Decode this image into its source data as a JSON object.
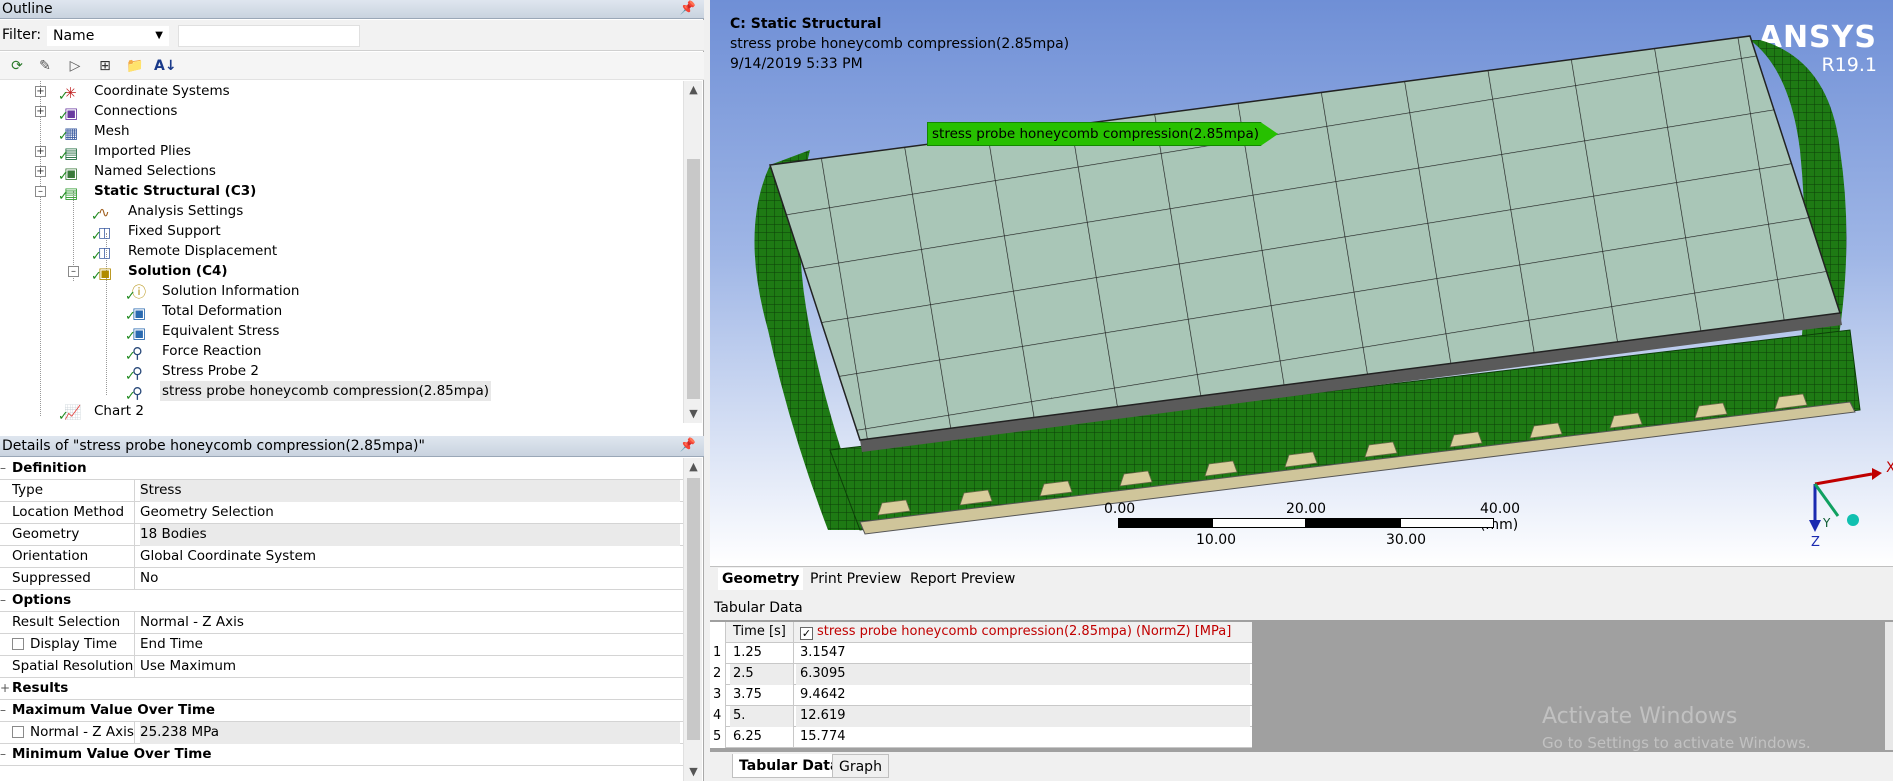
{
  "outline": {
    "title": "Outline",
    "filter_label": "Filter:",
    "filter_value": "Name",
    "filter_text": "",
    "tree": [
      {
        "label": "Coordinate Systems",
        "icon": "coordinate-systems-icon"
      },
      {
        "label": "Connections",
        "icon": "connections-icon"
      },
      {
        "label": "Mesh",
        "icon": "mesh-icon"
      },
      {
        "label": "Imported Plies",
        "icon": "imported-plies-icon"
      },
      {
        "label": "Named Selections",
        "icon": "named-selections-icon"
      },
      {
        "label": "Static Structural (C3)",
        "icon": "static-structural-icon"
      },
      {
        "label": "Analysis Settings",
        "icon": "analysis-settings-icon"
      },
      {
        "label": "Fixed Support",
        "icon": "fixed-support-icon"
      },
      {
        "label": "Remote Displacement",
        "icon": "remote-displacement-icon"
      },
      {
        "label": "Solution (C4)",
        "icon": "solution-icon"
      },
      {
        "label": "Solution Information",
        "icon": "solution-information-icon"
      },
      {
        "label": "Total Deformation",
        "icon": "total-deformation-icon"
      },
      {
        "label": "Equivalent Stress",
        "icon": "equivalent-stress-icon"
      },
      {
        "label": "Force Reaction",
        "icon": "force-reaction-icon"
      },
      {
        "label": "Stress Probe 2",
        "icon": "stress-probe-icon"
      },
      {
        "label": "stress probe honeycomb compression(2.85mpa)",
        "icon": "stress-probe-icon"
      },
      {
        "label": "Chart 2",
        "icon": "chart-icon"
      }
    ]
  },
  "details": {
    "title": "Details of \"stress probe honeycomb compression(2.85mpa)\"",
    "groups": {
      "definition": "Definition",
      "options": "Options",
      "results": "Results",
      "max": "Maximum Value Over Time",
      "min": "Minimum Value Over Time"
    },
    "rows": {
      "type": {
        "k": "Type",
        "v": "Stress"
      },
      "location": {
        "k": "Location Method",
        "v": "Geometry Selection"
      },
      "geometry": {
        "k": "Geometry",
        "v": "18 Bodies"
      },
      "orientation": {
        "k": "Orientation",
        "v": "Global Coordinate System"
      },
      "suppressed": {
        "k": "Suppressed",
        "v": "No"
      },
      "result_selection": {
        "k": "Result Selection",
        "v": "Normal - Z Axis"
      },
      "display_time": {
        "k": "Display Time",
        "v": "End Time"
      },
      "spatial": {
        "k": "Spatial Resolution",
        "v": "Use Maximum"
      },
      "normal_z": {
        "k": "Normal - Z Axis",
        "v": "25.238 MPa"
      }
    }
  },
  "viewport": {
    "analysis": "C: Static Structural",
    "result": "stress probe honeycomb compression(2.85mpa)",
    "date": "9/14/2019 5:33 PM",
    "brand": "ANSYS",
    "version": "R19.1",
    "probe_label": "stress probe honeycomb compression(2.85mpa)",
    "scale": {
      "t0": "0.00",
      "t20": "20.00",
      "t40": "40.00 (mm)",
      "t10": "10.00",
      "t30": "30.00"
    },
    "axes": {
      "x": "X",
      "y": "Y",
      "z": "Z"
    },
    "colors": {
      "mesh": "#1f7a14",
      "plate": "#a8c4b6",
      "tag": "#27c000"
    }
  },
  "view_tabs": [
    "Geometry",
    "Print Preview",
    "Report Preview"
  ],
  "tabular": {
    "title": "Tabular Data",
    "headers": [
      "Time [s]",
      "stress probe honeycomb compression(2.85mpa) (NormZ) [MPa]"
    ],
    "rows": [
      {
        "n": "1",
        "t": "1.25",
        "v": "3.1547"
      },
      {
        "n": "2",
        "t": "2.5",
        "v": "6.3095"
      },
      {
        "n": "3",
        "t": "3.75",
        "v": "9.4642"
      },
      {
        "n": "4",
        "t": "5.",
        "v": "12.619"
      },
      {
        "n": "5",
        "t": "6.25",
        "v": "15.774"
      }
    ],
    "watermark_1": "Activate Windows",
    "watermark_2": "Go to Settings to activate Windows."
  },
  "bottom_tabs": [
    "Tabular Data",
    "Graph"
  ]
}
